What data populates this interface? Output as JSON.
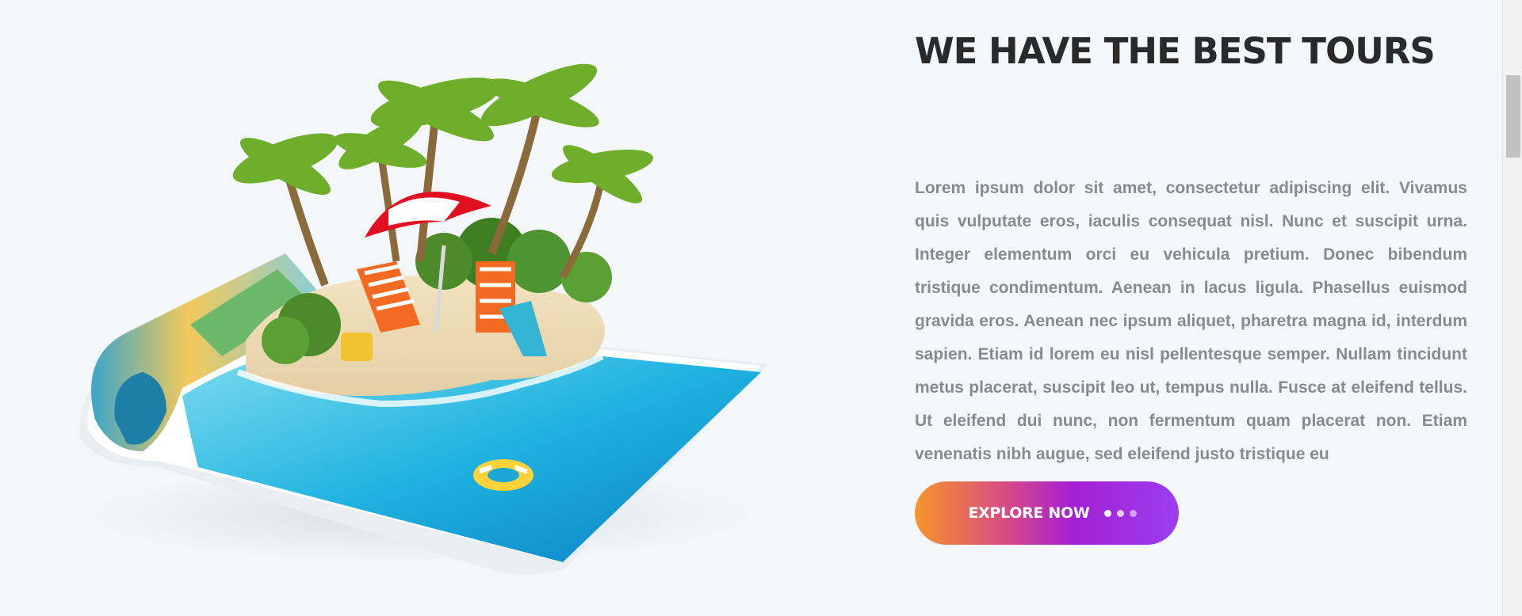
{
  "hero": {
    "title": "WE HAVE THE BEST TOURS",
    "body": "Lorem ipsum dolor sit amet, consectetur adipiscing elit. Vivamus quis vulputate eros, iaculis consequat nisl. Nunc et suscipit urna. Integer elementum orci eu vehicula pretium. Donec bibendum tristique condimentum. Aenean in lacus ligula. Phasellus euismod gravida eros. Aenean nec ipsum aliquet, pharetra magna id, interdum sapien. Etiam id lorem eu nisl pellentesque semper. Nullam tincidunt metus placerat, suscipit leo ut, tempus nulla. Fusce at eleifend tellus. Ut eleifend dui nunc, non fermentum quam placerat non. Etiam venenatis nibh augue, sed eleifend justo tristique eu",
    "button_label": "EXPLORE NOW",
    "button_icon": "three-dots-icon"
  },
  "illustration": {
    "icon": "tropical-island-magazine-illustration"
  },
  "colors": {
    "background": "#f3f7fa",
    "title": "#2a2a2a",
    "body": "#8a8a8a",
    "button_gradient": [
      "#f5952a",
      "#d74a86",
      "#a41fd4",
      "#9b3ef0"
    ]
  }
}
